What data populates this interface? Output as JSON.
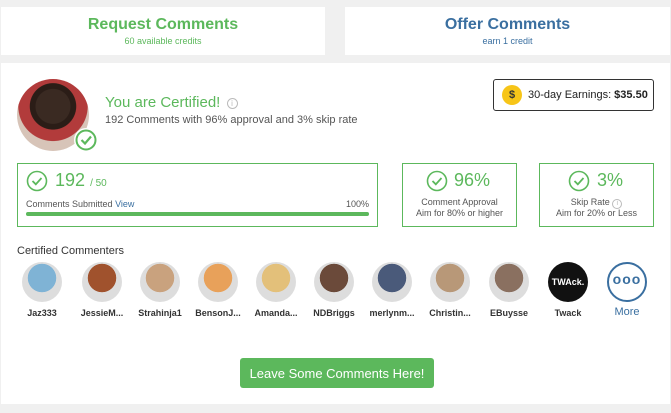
{
  "request": {
    "title": "Request Comments",
    "sub": "60 available credits"
  },
  "offer": {
    "title": "Offer Comments",
    "sub": "earn 1 credit"
  },
  "profile": {
    "certified_title": "You are Certified!",
    "info_glyph": "i",
    "description": "192 Comments with 96% approval and 3% skip rate"
  },
  "earnings": {
    "coin": "$",
    "label": "30-day Earnings:",
    "amount": "$35.50"
  },
  "stats": {
    "comments": {
      "value": "192",
      "goal": "/ 50",
      "label": "Comments Submitted",
      "link": "View",
      "pct": "100%",
      "progress": 1.0
    },
    "approval": {
      "value": "96%",
      "line1": "Comment Approval",
      "line2": "Aim for 80% or higher"
    },
    "skip": {
      "value": "3%",
      "line1": "Skip Rate",
      "line2": "Aim for 20% or Less"
    }
  },
  "commenters_title": "Certified Commenters",
  "commenters": [
    {
      "name": "Jaz333",
      "color": "#7fb3d5"
    },
    {
      "name": "JessieM...",
      "color": "#a0522d"
    },
    {
      "name": "Strahinja1",
      "color": "#c9a27e"
    },
    {
      "name": "BensonJ...",
      "color": "#e8a15a"
    },
    {
      "name": "Amanda...",
      "color": "#e3c07a"
    },
    {
      "name": "NDBriggs",
      "color": "#6b4a3a"
    },
    {
      "name": "merlynm...",
      "color": "#4a5a7a"
    },
    {
      "name": "Christin...",
      "color": "#b89878"
    },
    {
      "name": "EBuysse",
      "color": "#8a7060"
    },
    {
      "name": "Twack",
      "color": "#111111",
      "avatar_text": "TWAck."
    }
  ],
  "more": {
    "glyph": "ooo",
    "label": "More"
  },
  "leave_button": "Leave Some Comments Here!"
}
